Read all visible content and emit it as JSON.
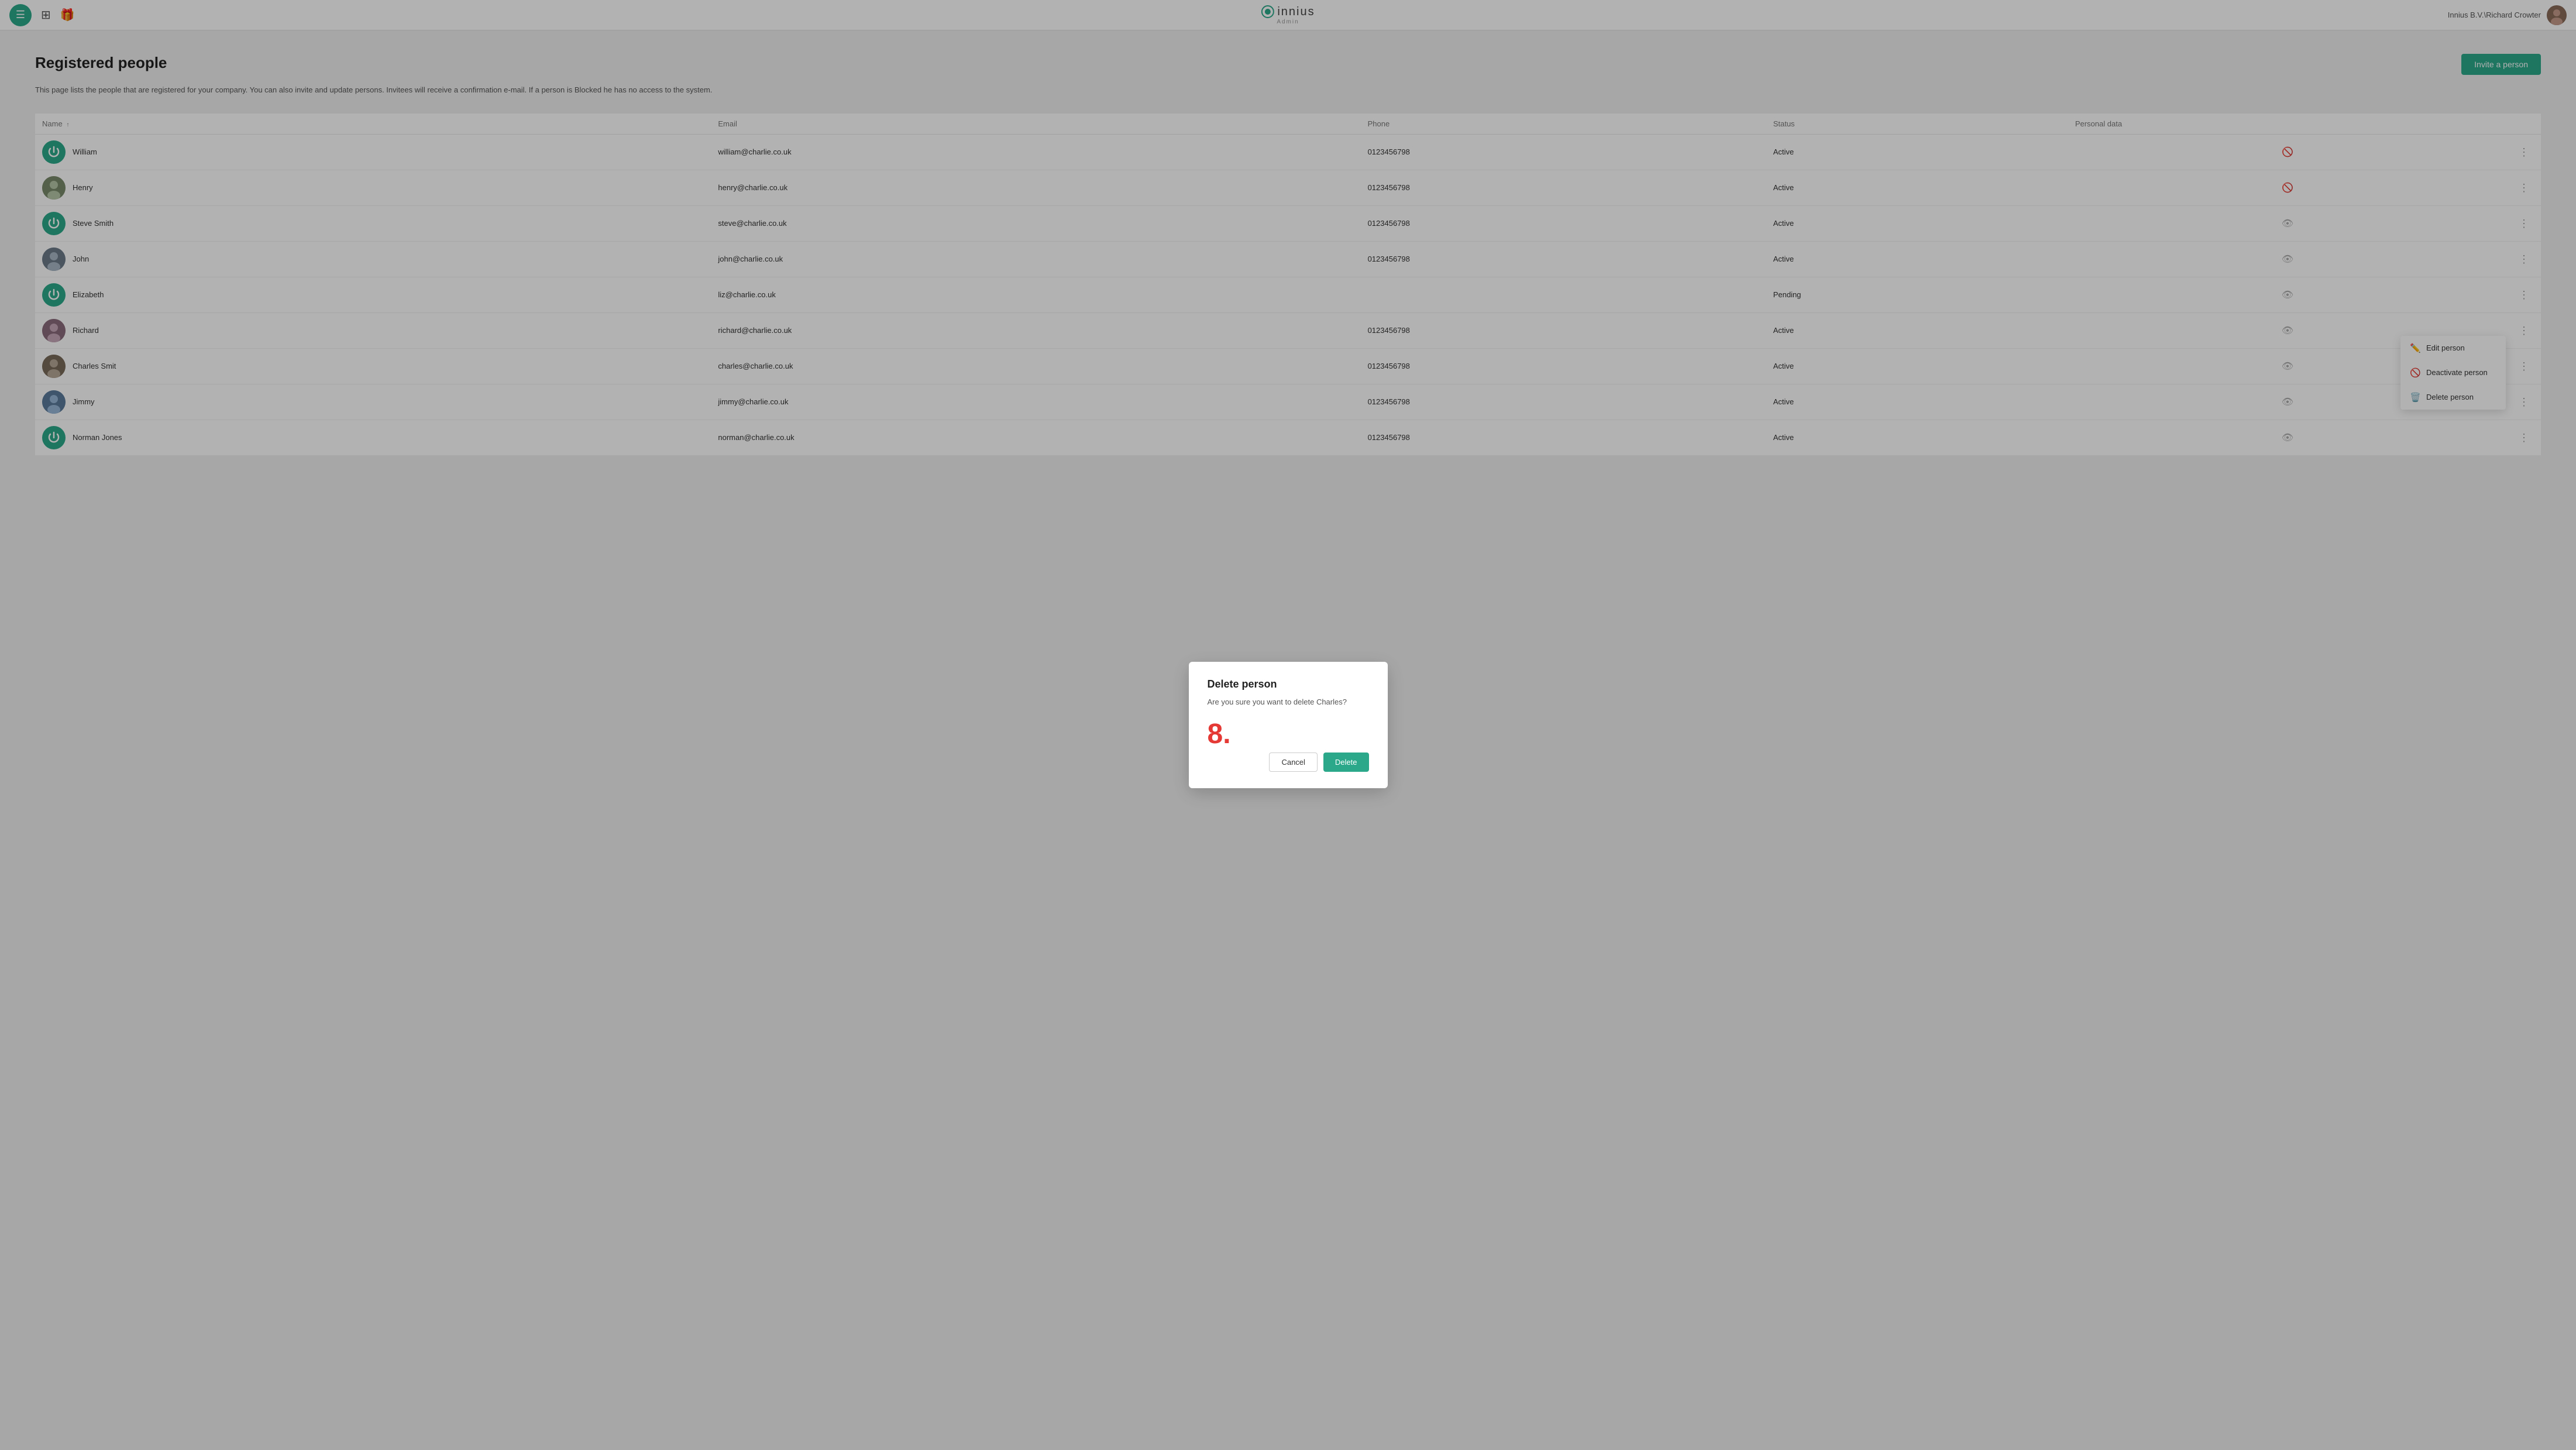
{
  "header": {
    "logo_text": "innius",
    "logo_sub": "Admin",
    "user_label": "Innius B.V.\\Richard Crowter"
  },
  "page": {
    "title": "Registered people",
    "description": "This page lists the people that are registered for your company. You can also invite and update persons. Invitees will receive a confirmation e-mail. If a person is Blocked he has no access to the system.",
    "invite_button": "Invite a person"
  },
  "table": {
    "columns": [
      "Name",
      "Email",
      "Phone",
      "Status",
      "Personal data"
    ],
    "rows": [
      {
        "id": 1,
        "name": "William",
        "email": "william@charlie.co.uk",
        "phone": "0123456798",
        "status": "Active",
        "avatar_type": "teal_power",
        "eye_hidden": true
      },
      {
        "id": 2,
        "name": "Henry",
        "email": "henry@charlie.co.uk",
        "phone": "0123456798",
        "status": "Active",
        "avatar_type": "photo_henry",
        "eye_hidden": true
      },
      {
        "id": 3,
        "name": "Steve Smith",
        "email": "steve@charlie.co.uk",
        "phone": "0123456798",
        "status": "Active",
        "avatar_type": "teal_power",
        "eye_hidden": false
      },
      {
        "id": 4,
        "name": "John",
        "email": "john@charlie.co.uk",
        "phone": "0123456798",
        "status": "Active",
        "avatar_type": "photo_john",
        "eye_hidden": false
      },
      {
        "id": 5,
        "name": "Elizabeth",
        "email": "liz@charlie.co.uk",
        "phone": "",
        "status": "Pending",
        "avatar_type": "teal_power",
        "eye_hidden": false
      },
      {
        "id": 6,
        "name": "Richard",
        "email": "richard@charlie.co.uk",
        "phone": "0123456798",
        "status": "Active",
        "avatar_type": "photo_richard",
        "eye_hidden": false
      },
      {
        "id": 7,
        "name": "Charles Smit",
        "email": "charles@charlie.co.uk",
        "phone": "0123456798",
        "status": "Active",
        "avatar_type": "photo_charles",
        "eye_hidden": false,
        "menu_open": true
      },
      {
        "id": 8,
        "name": "Jimmy",
        "email": "jimmy@charlie.co.uk",
        "phone": "0123456798",
        "status": "Active",
        "avatar_type": "photo_jimmy",
        "eye_hidden": false
      },
      {
        "id": 9,
        "name": "Norman Jones",
        "email": "norman@charlie.co.uk",
        "phone": "0123456798",
        "status": "Active",
        "avatar_type": "teal_power",
        "eye_hidden": false
      }
    ]
  },
  "context_menu": {
    "items": [
      {
        "id": "edit",
        "label": "Edit person",
        "icon": "pencil"
      },
      {
        "id": "deactivate",
        "label": "Deactivate person",
        "icon": "ban"
      },
      {
        "id": "delete",
        "label": "Delete person",
        "icon": "trash"
      }
    ]
  },
  "modal": {
    "title": "Delete person",
    "body": "Are you sure you want to delete Charles?",
    "step": "8.",
    "cancel_label": "Cancel",
    "delete_label": "Delete"
  }
}
